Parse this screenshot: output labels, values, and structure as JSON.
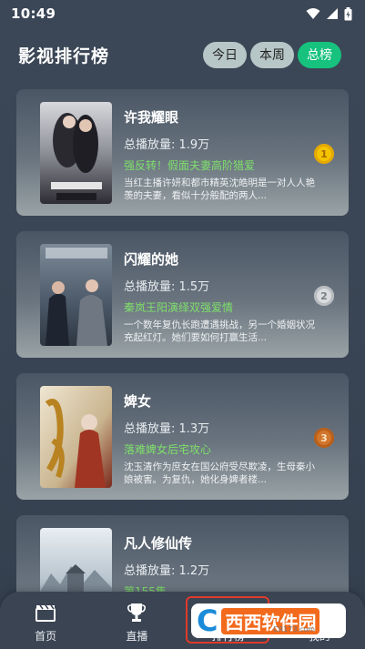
{
  "status_bar": {
    "time": "10:49",
    "icons": [
      "wifi-icon",
      "signal-icon",
      "battery-icon"
    ]
  },
  "header": {
    "title": "影视排行榜",
    "tabs": [
      {
        "label": "今日",
        "active": false
      },
      {
        "label": "本周",
        "active": false
      },
      {
        "label": "总榜",
        "active": true
      }
    ]
  },
  "ranking": [
    {
      "title": "许我耀眼",
      "plays": "总播放量: 1.9万",
      "tag": "强反转！假面夫妻高阶猎爱",
      "desc": "当红主播许妍和都市精英沈皓明是一对人人艳羡的夫妻，看似十分般配的两人...",
      "rank": "1",
      "poster_colors": [
        "#2b2a30",
        "#8a8f9a"
      ]
    },
    {
      "title": "闪耀的她",
      "plays": "总播放量: 1.5万",
      "tag": "秦岚王阳演绎双强爱情",
      "desc": "一个数年复仇长跑遭遇挑战，另一个婚姻状况充起红灯。她们要如何打赢生活...",
      "rank": "2",
      "poster_colors": [
        "#3d4b5c",
        "#9aa6b3"
      ]
    },
    {
      "title": "婢女",
      "plays": "总播放量: 1.3万",
      "tag": "落难婢女后宅攻心",
      "desc": "沈玉清作为庶女在国公府受尽欺凌，生母秦小娘被害。为复仇，她化身婢者楼...",
      "rank": "3",
      "poster_colors": [
        "#d9c9a8",
        "#8a2f1e"
      ]
    },
    {
      "title": "凡人修仙传",
      "plays": "总播放量: 1.2万",
      "tag": "第155集",
      "desc": "",
      "rank": "",
      "poster_colors": [
        "#c9d3db",
        "#6f7f8c"
      ]
    }
  ],
  "bottom_nav": [
    {
      "label": "首页",
      "icon": "clapperboard-icon"
    },
    {
      "label": "直播",
      "icon": "trophy-icon"
    },
    {
      "label": "排行榜",
      "icon": "ranking-icon"
    },
    {
      "label": "我的",
      "icon": "user-icon"
    }
  ],
  "watermark": {
    "text": "西西软件园",
    "url": "CR173.com"
  }
}
